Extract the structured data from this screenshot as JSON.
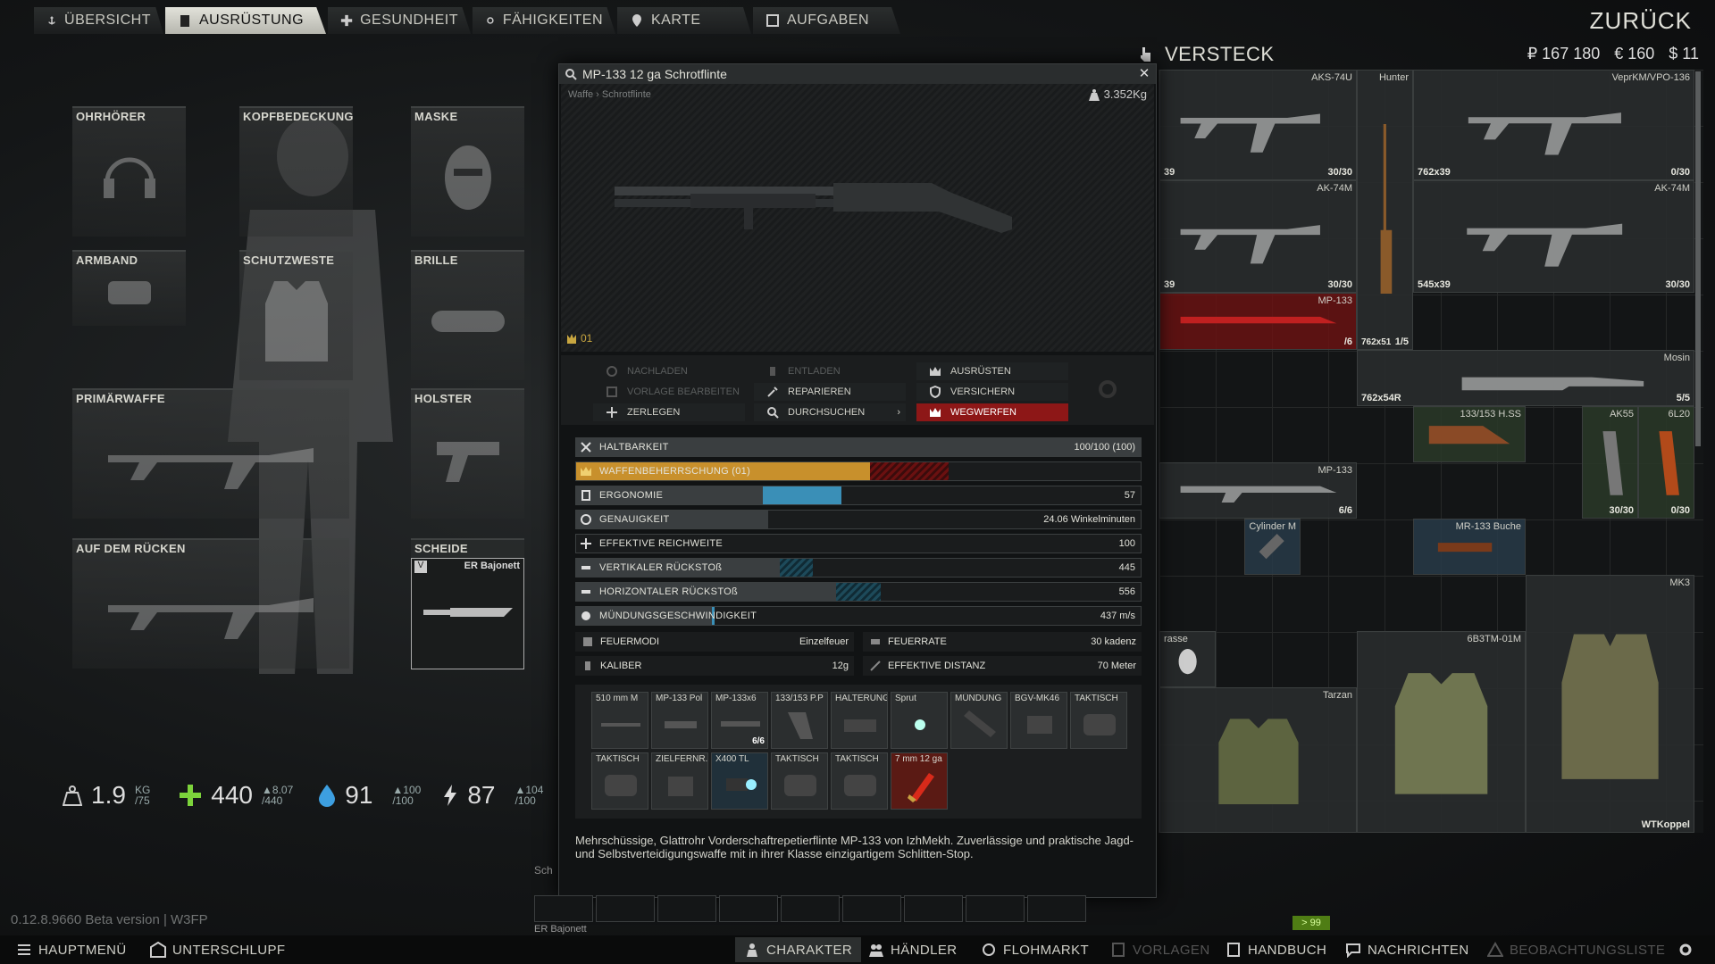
{
  "tabs": [
    {
      "label": "ÜBERSICHT",
      "icon": "anchor-icon"
    },
    {
      "label": "AUSRÜSTUNG",
      "icon": "gear-person-icon"
    },
    {
      "label": "GESUNDHEIT",
      "icon": "health-icon"
    },
    {
      "label": "FÄHIGKEITEN",
      "icon": "skills-icon"
    },
    {
      "label": "KARTE",
      "icon": "map-pin-icon"
    },
    {
      "label": "AUFGABEN",
      "icon": "tasks-icon"
    }
  ],
  "back_label": "ZURÜCK",
  "slots": {
    "earpiece": "OHRHÖRER",
    "headwear": "KOPFBEDECKUNG",
    "mask": "MASKE",
    "armband": "ARMBAND",
    "vest": "SCHUTZWESTE",
    "eyewear": "BRILLE",
    "primary": "PRIMÄRWAFFE",
    "holster": "HOLSTER",
    "back": "AUF DEM RÜCKEN",
    "scabbard": "SCHEIDE",
    "scabbard_item": "ER Bajonett"
  },
  "stats": {
    "weight": "1.9",
    "weight_unit": "KG",
    "weight_max": "/75",
    "health": "440",
    "health_rate": "8.07",
    "health_max": "/440",
    "hydration": "91",
    "hydration_max": "100",
    "hydration_sub": "/100",
    "energy": "87",
    "energy_max": "104",
    "energy_sub": "/100"
  },
  "version": "0.12.8.9660 Beta version | W3FP",
  "bottom": {
    "main_menu": "HAUPTMENÜ",
    "hideout": "UNTERSCHLUPF",
    "character": "CHARAKTER",
    "traders": "HÄNDLER",
    "flea": "FLOHMARKT",
    "presets": "VORLAGEN",
    "handbook": "HANDBUCH",
    "messages": "NACHRICHTEN",
    "watchlist": "BEOBACHTUNGSLISTE"
  },
  "stash": {
    "title": "VERSTECK",
    "money": {
      "rub": "₽ 167 180",
      "eur": "€ 160",
      "usd": "$ 11"
    },
    "items": [
      {
        "name": "AKS-74U",
        "count": "30/30",
        "cal": "39"
      },
      {
        "name": "Hunter",
        "count": "1/5",
        "cal": "762x51"
      },
      {
        "name": "VeprKM/VPO-136",
        "count": "0/30",
        "cal": "762x39"
      },
      {
        "name": "AK-74M",
        "count": "30/30",
        "cal": "39"
      },
      {
        "name": "AK-74M",
        "count": "30/30",
        "cal": "545x39"
      },
      {
        "name": "MP-133",
        "count": "/6",
        "cal": ""
      },
      {
        "name": "Mosin",
        "count": "5/5",
        "cal": "762x54R"
      },
      {
        "name": "133/153 H.SS",
        "count": "",
        "cal": ""
      },
      {
        "name": "AK55",
        "count": "30/30",
        "cal": ""
      },
      {
        "name": "6L20",
        "count": "0/30",
        "cal": ""
      },
      {
        "name": "MP-133",
        "count": "6/6",
        "cal": ""
      },
      {
        "name": "Cylinder M",
        "count": "",
        "cal": ""
      },
      {
        "name": "MR-133 Buche",
        "count": "",
        "cal": ""
      },
      {
        "name": "MK3",
        "count": "",
        "cal": ""
      },
      {
        "name": "rasse",
        "count": "",
        "cal": ""
      },
      {
        "name": "6B3TM-01M",
        "count": "",
        "cal": ""
      },
      {
        "name": "Tarzan",
        "count": "",
        "cal": ""
      },
      {
        "name": "WTKoppel",
        "count": "",
        "cal": ""
      }
    ],
    "green_tag": "> 99"
  },
  "inspect": {
    "title": "MP-133 12 ga Schrotflinte",
    "breadcrumb": "Waffe › Schrotflinte",
    "weight": "3.352Kg",
    "mastery_level": "01",
    "actions": {
      "reload": "NACHLADEN",
      "unload": "ENTLADEN",
      "equip": "AUSRÜSTEN",
      "edit_preset": "VORLAGE BEARBEITEN",
      "repair": "REPARIEREN",
      "insure": "VERSICHERN",
      "disassemble": "ZERLEGEN",
      "search": "DURCHSUCHEN",
      "discard": "WEGWERFEN"
    },
    "bars": [
      {
        "label": "HALTBARKEIT",
        "value": "100/100 (100)",
        "fill": 1.0
      },
      {
        "label": "WAFFENBEHERRSCHUNG (01)",
        "value": "",
        "fill": 0.52
      },
      {
        "label": "ERGONOMIE",
        "value": "57",
        "fill": 0.57
      },
      {
        "label": "GENAUIGKEIT",
        "value": "24.06 Winkelminuten",
        "fill": 0.35
      },
      {
        "label": "EFFEKTIVE REICHWEITE",
        "value": "100",
        "fill": 0.0
      },
      {
        "label": "VERTIKALER RÜCKSTOß",
        "value": "445",
        "fill": 0.45
      },
      {
        "label": "HORIZONTALER RÜCKSTOß",
        "value": "556",
        "fill": 0.56
      },
      {
        "label": "MÜNDUNGSGESCHWINDIGKEIT",
        "value": "437 m/s",
        "fill": 0.3
      }
    ],
    "fire_modes_label": "FEUERMODI",
    "fire_modes_value": "Einzelfeuer",
    "fire_rate_label": "FEUERRATE",
    "fire_rate_value": "30 kadenz",
    "caliber_label": "KALIBER",
    "caliber_value": "12g",
    "eff_dist_label": "EFFEKTIVE DISTANZ",
    "eff_dist_value": "70 Meter",
    "mods_row1": [
      {
        "name": "510 mm M",
        "count": ""
      },
      {
        "name": "MP-133 Pol",
        "count": ""
      },
      {
        "name": "MP-133x6",
        "count": "6/6"
      },
      {
        "name": "133/153 P.P",
        "count": ""
      },
      {
        "name": "HALTERUNG",
        "count": ""
      },
      {
        "name": "Sprut",
        "count": ""
      },
      {
        "name": "MÜNDUNG",
        "count": ""
      },
      {
        "name": "BGV-MK46",
        "count": ""
      },
      {
        "name": "TAKTISCH",
        "count": ""
      }
    ],
    "mods_row2": [
      {
        "name": "TAKTISCH",
        "count": ""
      },
      {
        "name": "ZIELFERNR.",
        "count": ""
      },
      {
        "name": "X400 TL",
        "count": ""
      },
      {
        "name": "TAKTISCH",
        "count": ""
      },
      {
        "name": "TAKTISCH",
        "count": ""
      },
      {
        "name": "7 mm 12 ga",
        "count": ""
      }
    ],
    "description": "Mehrschüssige, Glattrohr Vorderschaftrepetierflinte MP-133 von IzhMekh. Zuverlässige und praktische Jagd- und Selbstverteidigungswaffe mit in ihrer Klasse einzigartigem Schlitten-Stop."
  },
  "quick": {
    "label": "Sch",
    "item": "ER Bajonett"
  },
  "colors": {
    "mastery": "#c8902c",
    "ergonomics": "#3a8fb7",
    "discard": "#8d1717"
  }
}
